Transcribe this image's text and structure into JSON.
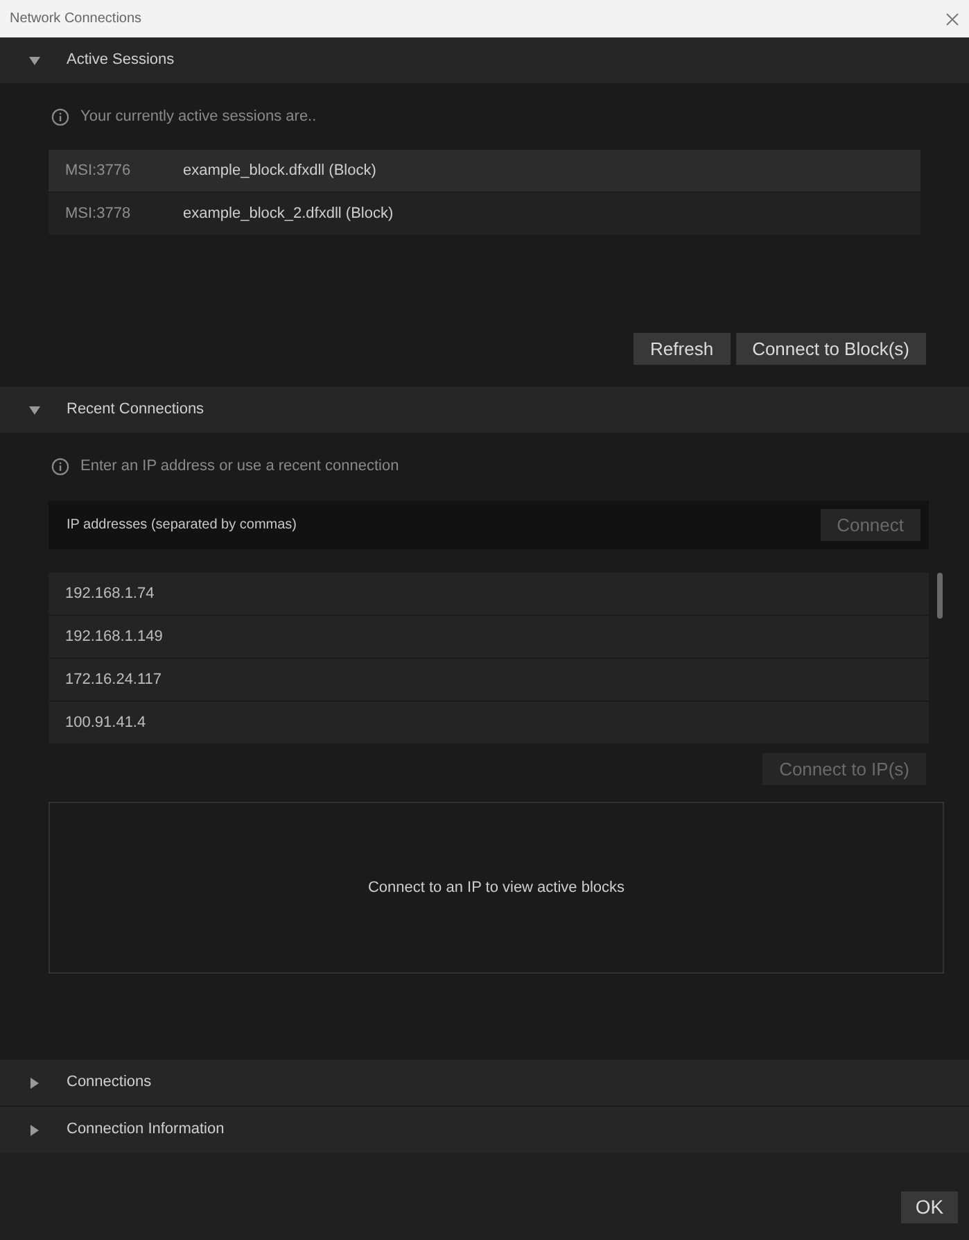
{
  "window": {
    "title": "Network Connections"
  },
  "active_sessions": {
    "title": "Active Sessions",
    "expanded": true,
    "info": "Your currently active sessions are..",
    "sessions": [
      {
        "id": "MSI:3776",
        "name": "example_block.dfxdll (Block)",
        "selected": true
      },
      {
        "id": "MSI:3778",
        "name": "example_block_2.dfxdll (Block)",
        "selected": false
      }
    ],
    "buttons": [
      {
        "label": "Refresh",
        "disabled": false
      },
      {
        "label": "Connect to Block(s)",
        "disabled": false
      }
    ]
  },
  "recent_connections": {
    "title": "Recent Connections",
    "expanded": true,
    "info": "Enter an IP address or use a recent connection",
    "ip_field": {
      "placeholder": "IP addresses (separated by commas)"
    },
    "connect_button": {
      "label": "Connect",
      "disabled": true
    },
    "addresses": [
      {
        "label": "192.168.1.74",
        "selected": false
      },
      {
        "label": "192.168.1.149",
        "selected": false
      },
      {
        "label": "172.16.24.117",
        "selected": false
      },
      {
        "label": "100.91.41.4",
        "selected": false
      }
    ],
    "connect_ips_button": {
      "label": "Connect to IP(s)",
      "disabled": true
    },
    "empty_message": "Connect to an IP to view active blocks"
  },
  "collapsed_sections": [
    {
      "title": "Connections",
      "expanded": false
    },
    {
      "title": "Connection Information",
      "expanded": false
    }
  ],
  "ok_button": {
    "label": "OK"
  }
}
